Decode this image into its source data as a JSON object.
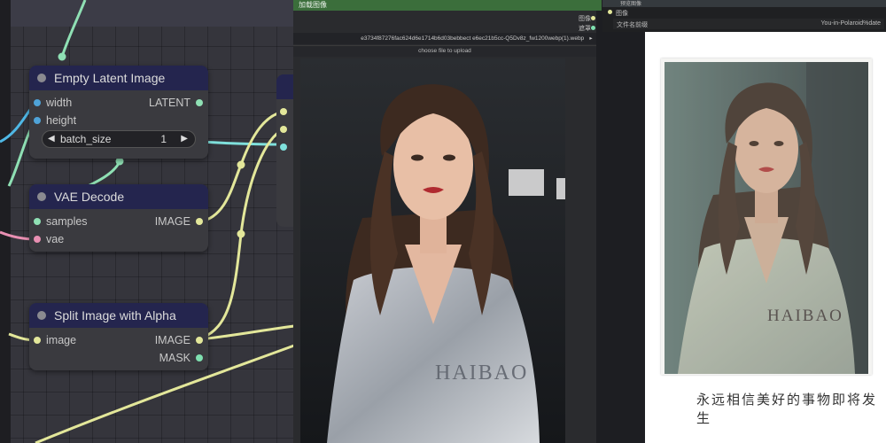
{
  "nodes": {
    "empty_latent": {
      "title": "Empty Latent Image",
      "inputs": [
        "width",
        "height"
      ],
      "output": "LATENT",
      "widget": {
        "label": "batch_size",
        "value": "1"
      }
    },
    "vae_decode": {
      "title": "VAE Decode",
      "inputs": [
        "samples",
        "vae"
      ],
      "output": "IMAGE"
    },
    "split_alpha": {
      "title": "Split Image with Alpha",
      "inputs": [
        "image"
      ],
      "outputs": [
        "IMAGE",
        "MASK"
      ]
    }
  },
  "load_image": {
    "title": "加载图像",
    "filename": "e3734f87276fac624d6e1714b6d03bebbect e6ec21b5cc-Q5Dv8z_fw1200webp(1).webp",
    "upload_label": "choose file to upload",
    "outputs": [
      "图像",
      "遮罩"
    ],
    "watermark": "HAIBAO"
  },
  "preview_image": {
    "title": "预览图像",
    "input": "图像",
    "file_label": "文件名前缀",
    "file_value": "You-in-Polaroid%date",
    "watermark": "HAIBAO",
    "caption": "永远相信美好的事物即将发生"
  },
  "colors": {
    "node_header": "#24254e",
    "node_body": "#3a3a3f",
    "wire_image": "#e3e79a",
    "wire_latent": "#8fe0b4",
    "wire_vae": "#e88fb2",
    "wire_cyan": "#7fe0dc",
    "load_header": "#3b6e3b"
  }
}
